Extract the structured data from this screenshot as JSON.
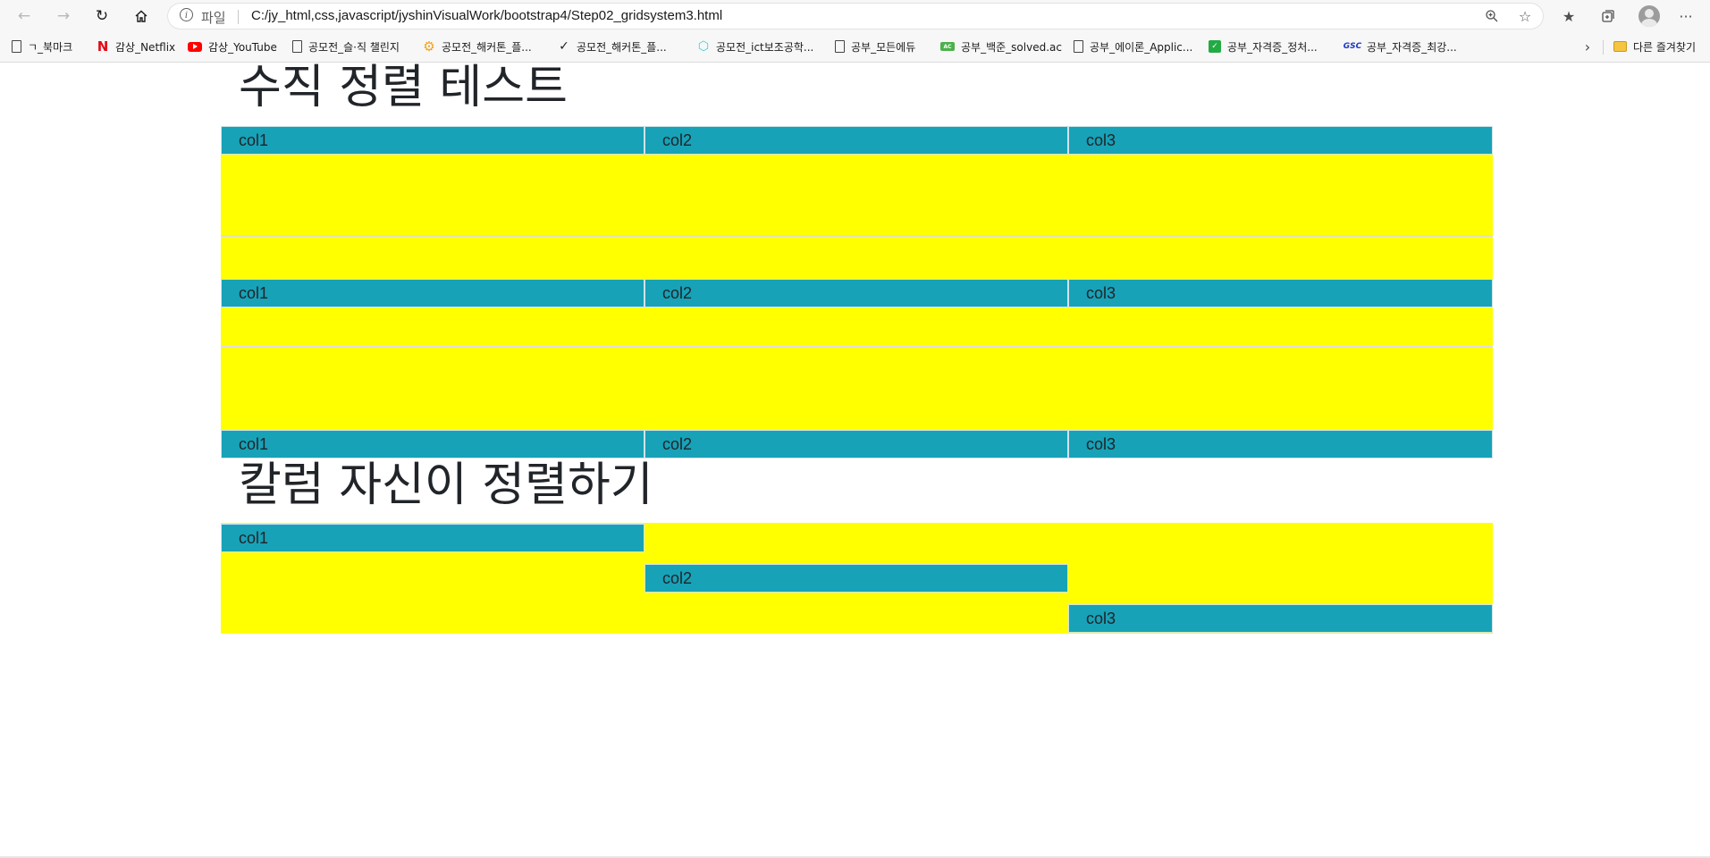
{
  "browser": {
    "address": {
      "scheme_label": "파일",
      "url": "C:/jy_html,css,javascript/jyshinVisualWork/bootstrap4/Step02_gridsystem3.html"
    },
    "bookmarks": [
      {
        "icon": "page-icon",
        "label": "ㄱ_북마크"
      },
      {
        "icon": "netflix-icon",
        "label": "감상_Netflix"
      },
      {
        "icon": "youtube-icon",
        "label": "감상_YouTube"
      },
      {
        "icon": "page-icon",
        "label": "공모전_슬·직 챌린지"
      },
      {
        "icon": "gear-icon",
        "label": "공모전_해커톤_플..."
      },
      {
        "icon": "check-icon",
        "label": "공모전_해커톤_플..."
      },
      {
        "icon": "hexagon-icon",
        "label": "공모전_ict보조공학..."
      },
      {
        "icon": "page-icon",
        "label": "공부_모든에듀"
      },
      {
        "icon": "solvedac-icon",
        "label": "공부_백준_solved.ac"
      },
      {
        "icon": "page-icon",
        "label": "공부_에이론_Applic..."
      },
      {
        "icon": "green-book-icon",
        "label": "공부_자격증_정처..."
      },
      {
        "icon": "gsc-icon",
        "label": "공부_자격증_최강..."
      }
    ],
    "other_bookmarks": "다른 즐겨찾기"
  },
  "page": {
    "heading1": "수직 정렬 테스트",
    "vertical_rows": [
      {
        "cols": [
          "col1",
          "col2",
          "col3"
        ]
      },
      {
        "cols": [
          "col1",
          "col2",
          "col3"
        ]
      },
      {
        "cols": [
          "col1",
          "col2",
          "col3"
        ]
      }
    ],
    "heading2": "칼럼 자신이 정렬하기",
    "self_align_cols": [
      "col1",
      "col2",
      "col3"
    ]
  },
  "colors": {
    "row_background": "#ffff00",
    "col_background": "#17a2b8"
  }
}
